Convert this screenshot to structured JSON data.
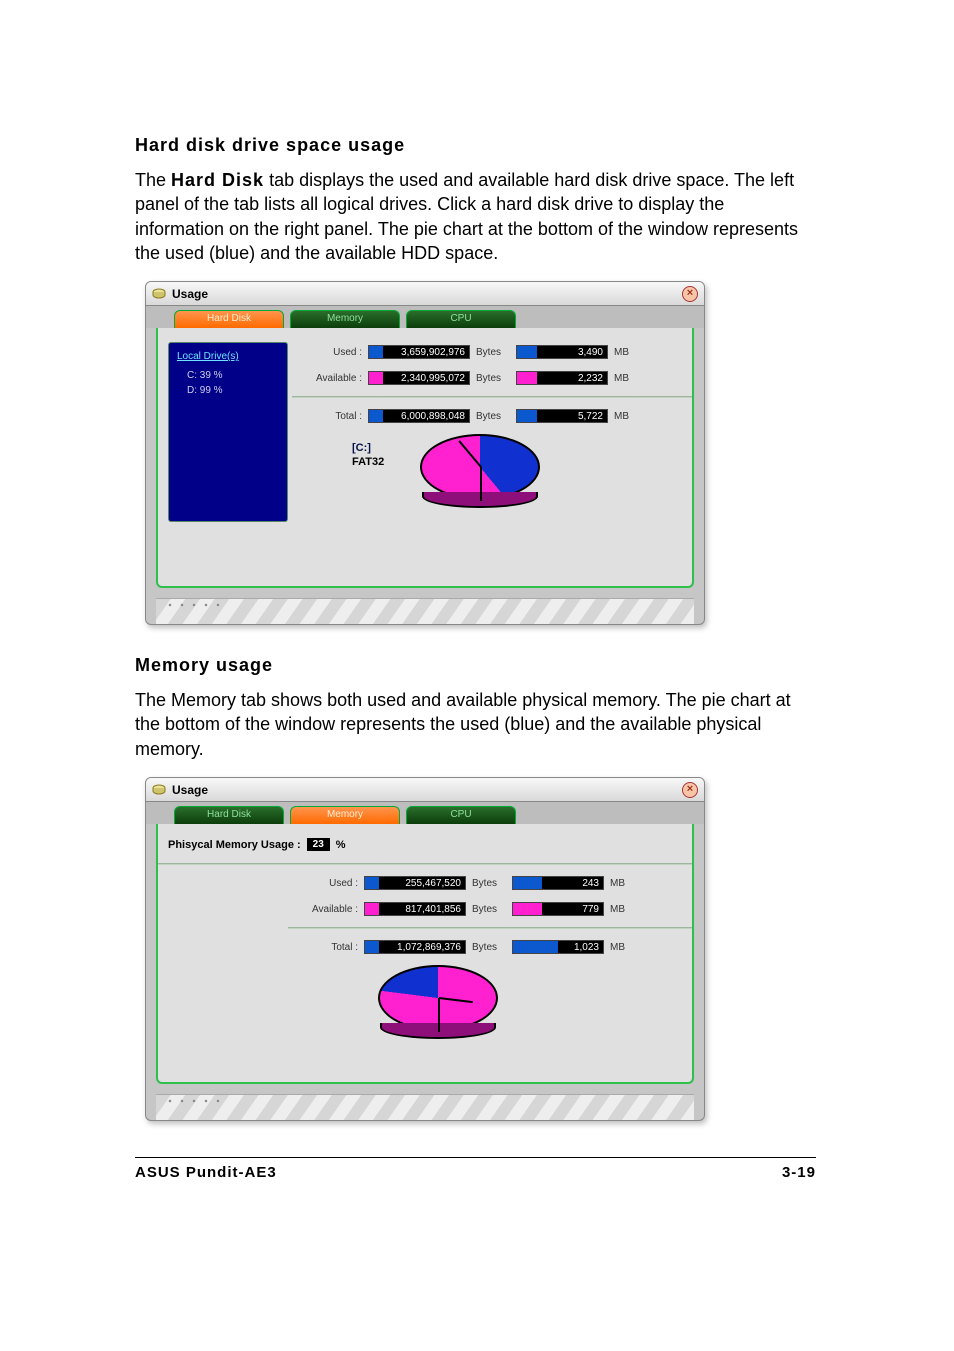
{
  "sections": {
    "hd_heading": "Hard disk drive space usage",
    "hd_body_pre": "The ",
    "hd_body_bold": "Hard Disk",
    "hd_body_post": " tab displays the used and available hard disk drive space. The left panel of the tab lists all logical drives. Click a hard disk drive to display the information on the right panel. The pie chart at the bottom of the window represents the used (blue) and the available HDD space.",
    "mem_heading": "Memory usage",
    "mem_body": "The Memory tab shows both used and available physical memory. The pie chart at the bottom of the window represents the used (blue) and the available physical memory."
  },
  "footer": {
    "left": "ASUS Pundit-AE3",
    "right": "3-19"
  },
  "window": {
    "title": "Usage"
  },
  "tabs": {
    "hard_disk": "Hard Disk",
    "memory": "Memory",
    "cpu": "CPU"
  },
  "hd": {
    "drive_panel_header": "Local Drive(s)",
    "drives": [
      {
        "label": "C: 39 %"
      },
      {
        "label": "D: 99 %"
      }
    ],
    "rows": {
      "used": {
        "label": "Used :",
        "bytes": "3,659,902,976",
        "mb": "3,490"
      },
      "available": {
        "label": "Available :",
        "bytes": "2,340,995,072",
        "mb": "2,232"
      },
      "total": {
        "label": "Total :",
        "bytes": "6,000,898,048",
        "mb": "5,722"
      }
    },
    "units": {
      "bytes": "Bytes",
      "mb": "MB"
    },
    "drive_label": "[C:]",
    "fs_label": "FAT32"
  },
  "mem": {
    "usage_label": "Phisycal Memory Usage :",
    "usage_value": "23",
    "usage_unit": "%",
    "rows": {
      "used": {
        "label": "Used :",
        "bytes": "255,467,520",
        "mb": "243"
      },
      "available": {
        "label": "Available :",
        "bytes": "817,401,856",
        "mb": "779"
      },
      "total": {
        "label": "Total :",
        "bytes": "1,072,869,376",
        "mb": "1,023"
      }
    },
    "units": {
      "bytes": "Bytes",
      "mb": "MB"
    }
  },
  "chart_data": [
    {
      "type": "pie",
      "title": "Hard Disk C: Usage",
      "series": [
        {
          "name": "Used",
          "value": 3490,
          "unit": "MB",
          "color": "#1030d0"
        },
        {
          "name": "Available",
          "value": 2232,
          "unit": "MB",
          "color": "#ff20d0"
        }
      ]
    },
    {
      "type": "pie",
      "title": "Physical Memory Usage",
      "series": [
        {
          "name": "Used",
          "value": 243,
          "unit": "MB",
          "color": "#1030d0"
        },
        {
          "name": "Available",
          "value": 779,
          "unit": "MB",
          "color": "#ff20d0"
        }
      ]
    }
  ]
}
